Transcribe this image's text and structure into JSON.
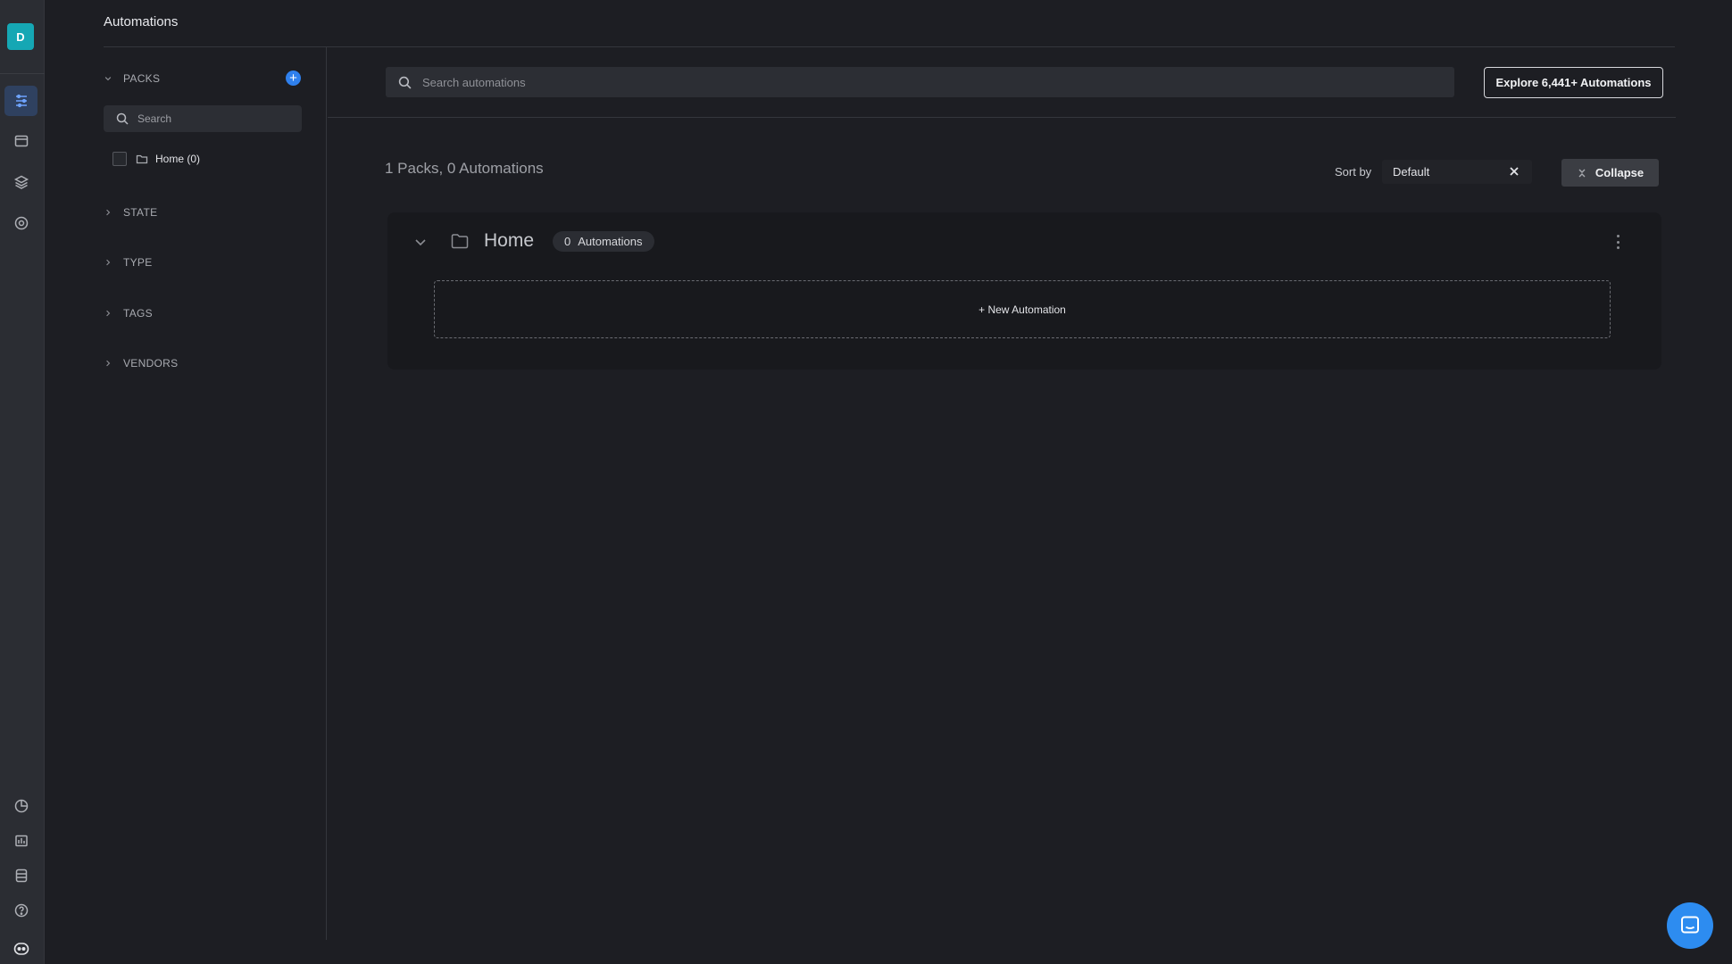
{
  "header": {
    "title": "Automations"
  },
  "rail": {
    "avatar_letter": "D"
  },
  "filters": {
    "sections": [
      {
        "label": "PACKS"
      },
      {
        "label": "STATE"
      },
      {
        "label": "TYPE"
      },
      {
        "label": "TAGS"
      },
      {
        "label": "VENDORS"
      }
    ],
    "add_icon": "+",
    "search_placeholder": "Search",
    "packs": [
      {
        "label": "Home (0)"
      }
    ]
  },
  "main": {
    "search_placeholder": "Search automations",
    "explore_label": "Explore 6,441+ Automations",
    "summary": "1 Packs, 0 Automations",
    "sort_label": "Sort by",
    "sort_value": "Default",
    "collapse_label": "Collapse"
  },
  "pack_card": {
    "title": "Home",
    "count": "0",
    "count_label": "Automations",
    "new_automation_label": "+ New Automation"
  },
  "colors": {
    "accent": "#2f80ed",
    "avatar": "#15a7b4",
    "chat": "#2d8cf0"
  },
  "icons": {
    "rail_top": [
      "automations-icon",
      "calendar-icon",
      "layers-icon",
      "settings-icon"
    ],
    "rail_bottom": [
      "activity-icon",
      "reports-icon",
      "database-icon",
      "help-icon",
      "bot-icon"
    ]
  }
}
